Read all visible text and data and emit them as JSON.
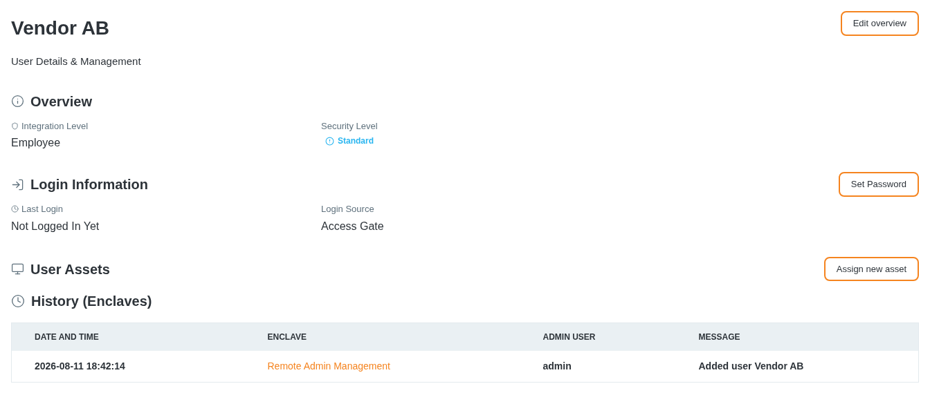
{
  "header": {
    "title": "Vendor AB",
    "subtitle": "User Details & Management",
    "button": "Edit overview"
  },
  "sections": [
    {
      "title": "Overview",
      "fields": [
        {
          "label": "Integration Level",
          "value": "Employee",
          "kind": "text"
        },
        {
          "label": "Security Level",
          "value": "Standard",
          "kind": "status"
        }
      ]
    },
    {
      "title": "Login Information",
      "button": "Set Password",
      "fields": [
        {
          "label": "Last Login",
          "value": "Not Logged In Yet",
          "kind": "text"
        },
        {
          "label": "Login Source",
          "value": "Access Gate",
          "kind": "text"
        }
      ]
    },
    {
      "title": "User Assets",
      "button": "Assign new asset"
    }
  ],
  "history": {
    "title": "History (Enclaves)",
    "columns": [
      "DATE AND TIME",
      "ENCLAVE",
      "ADMIN USER",
      "MESSAGE"
    ],
    "rows": [
      {
        "cells": [
          "2026-08-11 18:42:14",
          "Remote Admin Management",
          "admin",
          "Added user Vendor AB"
        ]
      }
    ]
  }
}
